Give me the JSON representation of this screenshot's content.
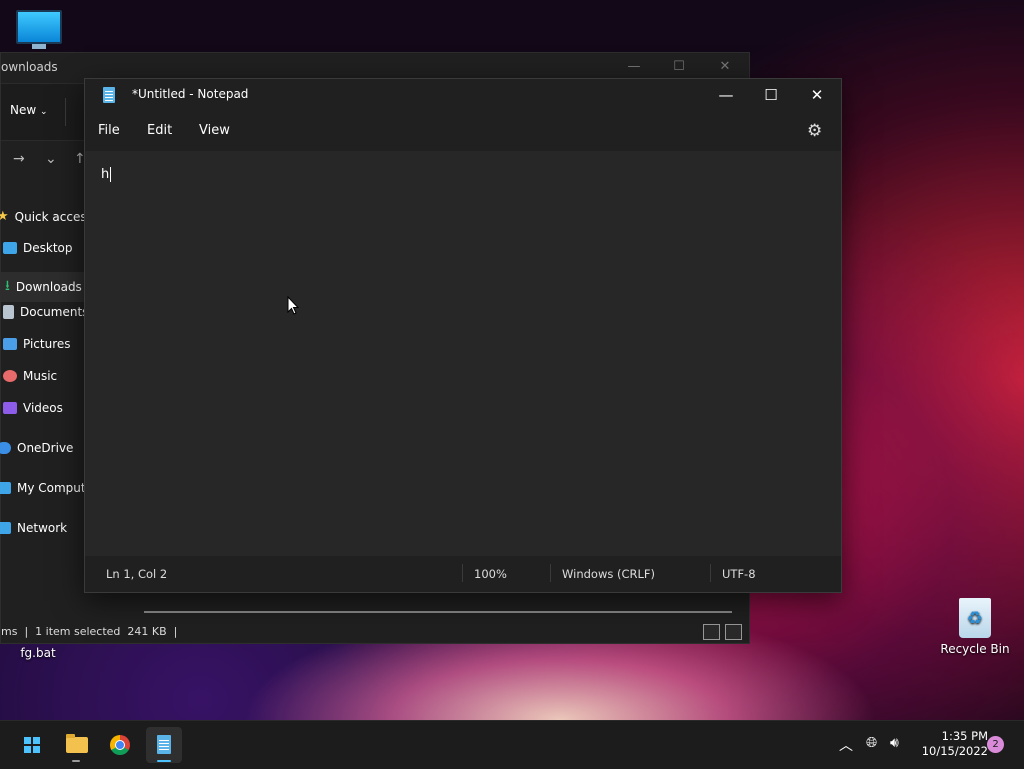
{
  "desktop": {
    "icons": [
      {
        "label": ""
      },
      {
        "label": "Recycle Bin"
      },
      {
        "label": "fg.bat"
      }
    ]
  },
  "explorer": {
    "title": "ownloads",
    "toolbar": {
      "new_label": "New"
    },
    "nav": [
      {
        "label": "Quick access",
        "icon": "star-icon",
        "color": "#f7c948"
      },
      {
        "label": "Desktop",
        "icon": "desktop-folder-icon",
        "color": "#3ea6e8"
      },
      {
        "label": "Downloads",
        "icon": "download-icon",
        "color": "#2fbf71",
        "selected": true
      },
      {
        "label": "Documents",
        "icon": "documents-icon",
        "color": "#b8c4cf"
      },
      {
        "label": "Pictures",
        "icon": "pictures-icon",
        "color": "#4a9fe8"
      },
      {
        "label": "Music",
        "icon": "music-icon",
        "color": "#e86a6a"
      },
      {
        "label": "Videos",
        "icon": "videos-icon",
        "color": "#8d5ce8"
      },
      {
        "label": "OneDrive",
        "icon": "cloud-icon",
        "color": "#3a8ee6"
      },
      {
        "label": "My Compute",
        "icon": "computer-icon",
        "color": "#3ea6e8"
      },
      {
        "label": "Network",
        "icon": "network-icon",
        "color": "#3ea6e8"
      }
    ],
    "status": "ms  |  1 item selected  241 KB  |"
  },
  "notepad": {
    "title": "*Untitled - Notepad",
    "menu": [
      "File",
      "Edit",
      "View"
    ],
    "content": "h",
    "status": {
      "position": "Ln 1, Col 2",
      "zoom": "100%",
      "line_ending": "Windows (CRLF)",
      "encoding": "UTF-8"
    }
  },
  "taskbar": {
    "clock_time": "1:35 PM",
    "clock_date": "10/15/2022",
    "notification_count": "2"
  }
}
